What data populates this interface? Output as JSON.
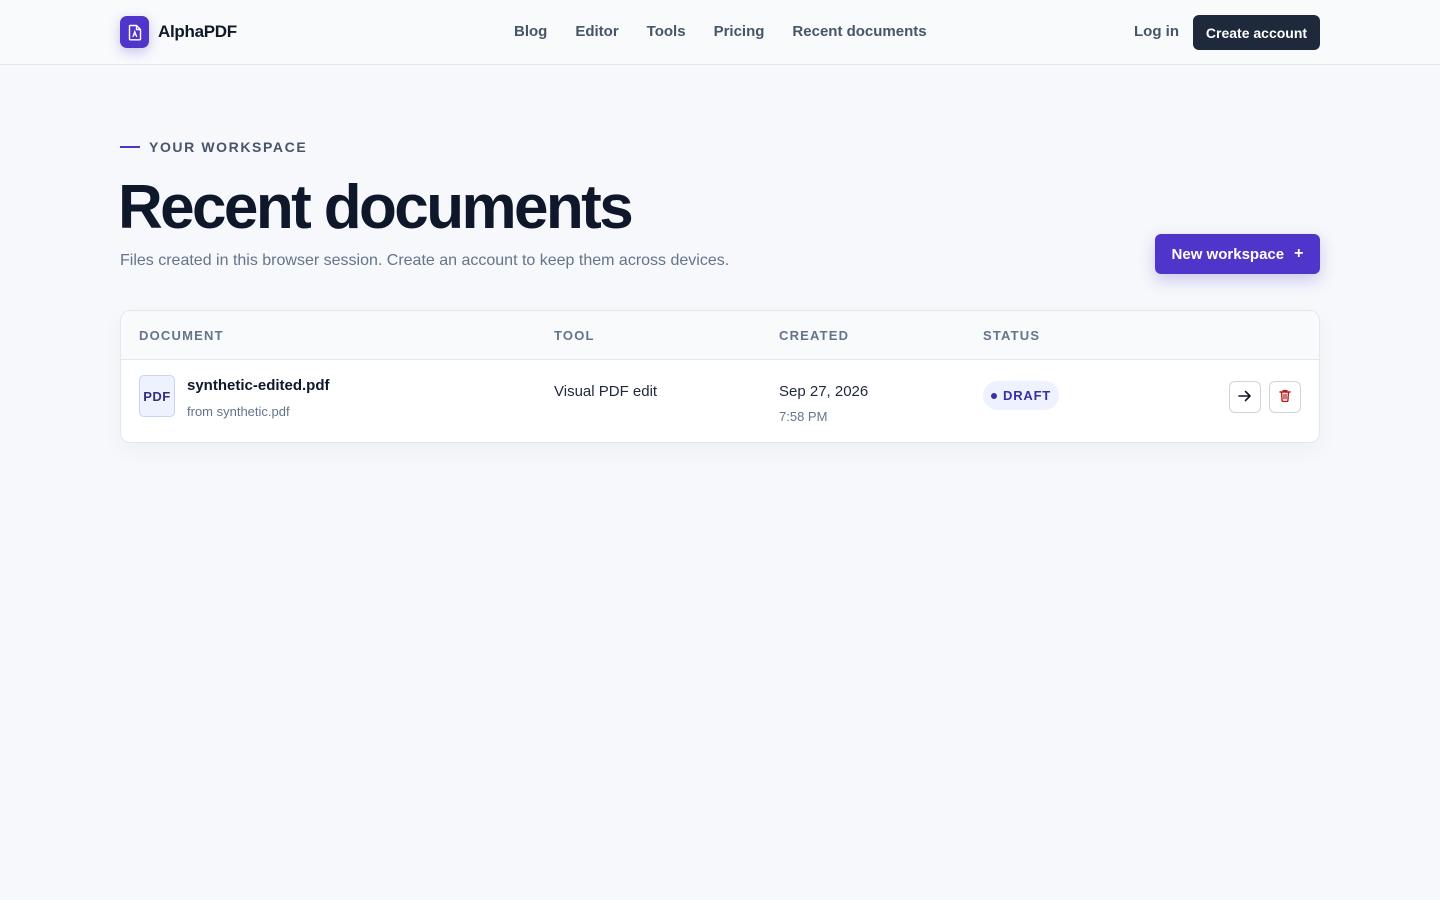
{
  "header": {
    "brand_name": "AlphaPDF",
    "logo_icon": "pdf-file-icon",
    "nav": [
      {
        "label": "Blog"
      },
      {
        "label": "Editor"
      },
      {
        "label": "Tools"
      },
      {
        "label": "Pricing"
      },
      {
        "label": "Recent documents"
      }
    ],
    "login_label": "Log in",
    "create_account_label": "Create account"
  },
  "hero": {
    "eyebrow": "YOUR WORKSPACE",
    "title": "Recent documents",
    "subtitle": "Files created in this browser session. Create an account to keep them across devices.",
    "new_workspace_label": "New workspace",
    "new_workspace_icon": "+"
  },
  "table": {
    "columns": [
      "DOCUMENT",
      "TOOL",
      "CREATED",
      "STATUS"
    ],
    "rows": [
      {
        "file_type": "PDF",
        "name": "synthetic-edited.pdf",
        "source": "from synthetic.pdf",
        "tool": "Visual PDF edit",
        "date": "Sep 27, 2026",
        "time": "7:58 PM",
        "status": "DRAFT",
        "actions": [
          "arrow-right-icon",
          "trash-icon"
        ]
      }
    ]
  },
  "colors": {
    "accent": "#4f35c9",
    "dark_button": "#1e293b",
    "background": "#f6f8fb",
    "delete_red": "#b91c1c"
  }
}
